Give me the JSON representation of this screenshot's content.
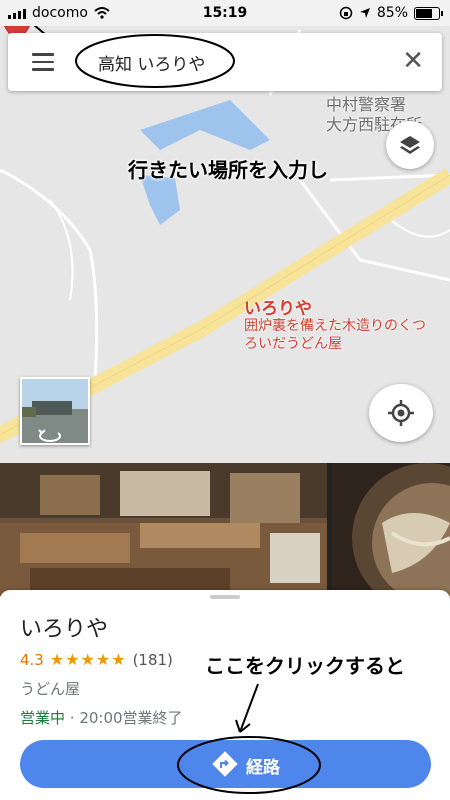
{
  "status_bar": {
    "carrier": "docomo",
    "time": "15:19",
    "battery": "85%",
    "battery_level": 0.85
  },
  "search": {
    "query": "高知 いろりや"
  },
  "map": {
    "label_police": "中村警察署\n大方西駐在所",
    "annotation": "行きたい場所を入力し",
    "place_title": "いろりや",
    "place_desc": "囲炉裏を備えた木造りのくつろいだうどん屋"
  },
  "place": {
    "name": "いろりや",
    "rating": "4.3",
    "stars": "★★★★★",
    "review_count": "(181)",
    "category": "うどん屋",
    "open_status": "営業中",
    "hours_detail": " · 20:00営業終了",
    "route_label": "経路",
    "annotation": "ここをクリックすると"
  },
  "colors": {
    "route_button": "#4f86ec",
    "place_red": "#d23f31",
    "open_green": "#188038",
    "rating_orange": "#e37400"
  }
}
